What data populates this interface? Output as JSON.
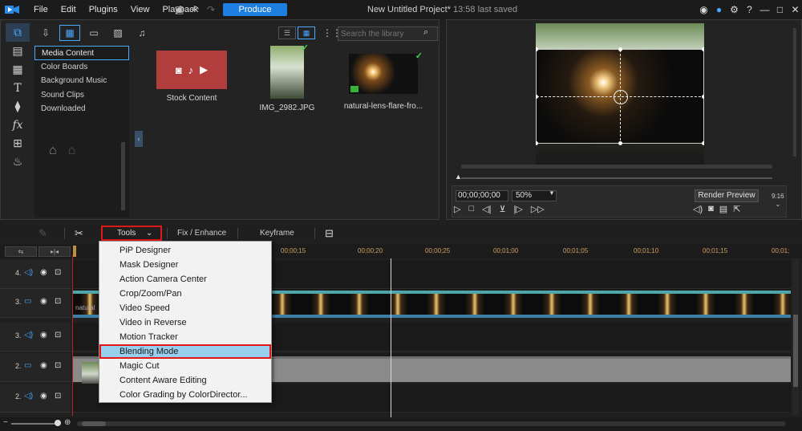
{
  "menu": [
    "File",
    "Edit",
    "Plugins",
    "View",
    "Playback"
  ],
  "produce_label": "Produce",
  "project": {
    "title": "New Untitled Project*",
    "saved": "13:58 last saved"
  },
  "library": {
    "search_placeholder": "Search the library",
    "categories": [
      "Media Content",
      "Color Boards",
      "Background Music",
      "Sound Clips",
      "Downloaded"
    ],
    "selected_category": "Media Content",
    "media": [
      {
        "caption": "Stock Content"
      },
      {
        "caption": "IMG_2982.JPG"
      },
      {
        "caption": "natural-lens-flare-fro..."
      }
    ]
  },
  "preview": {
    "timecode": "00;00;00;00",
    "zoom": "50%",
    "render_label": "Render Preview",
    "aspect": "9:16"
  },
  "toolbar": {
    "tools_label": "Tools",
    "fix_label": "Fix / Enhance",
    "keyframe_label": "Keyframe"
  },
  "ruler": [
    "00;00;15",
    "00;00;20",
    "00;00;25",
    "00;01;00",
    "00;01;05",
    "00;01;10",
    "00;01;15",
    "00;01;"
  ],
  "tracks": [
    {
      "name": "4."
    },
    {
      "name": "3.",
      "clip_label": "natural"
    },
    {
      "name": "3."
    },
    {
      "name": "2."
    },
    {
      "name": "2."
    }
  ],
  "tools_menu": [
    "PiP Designer",
    "Mask Designer",
    "Action Camera Center",
    "Crop/Zoom/Pan",
    "Video Speed",
    "Video in Reverse",
    "Motion Tracker",
    "Blending Mode",
    "Magic Cut",
    "Content Aware Editing",
    "Color Grading by ColorDirector..."
  ],
  "highlighted_tool": "Blending Mode",
  "colors": {
    "accent": "#1f7fe0",
    "highlight": "#99cfee",
    "annotation": "#e01818"
  }
}
